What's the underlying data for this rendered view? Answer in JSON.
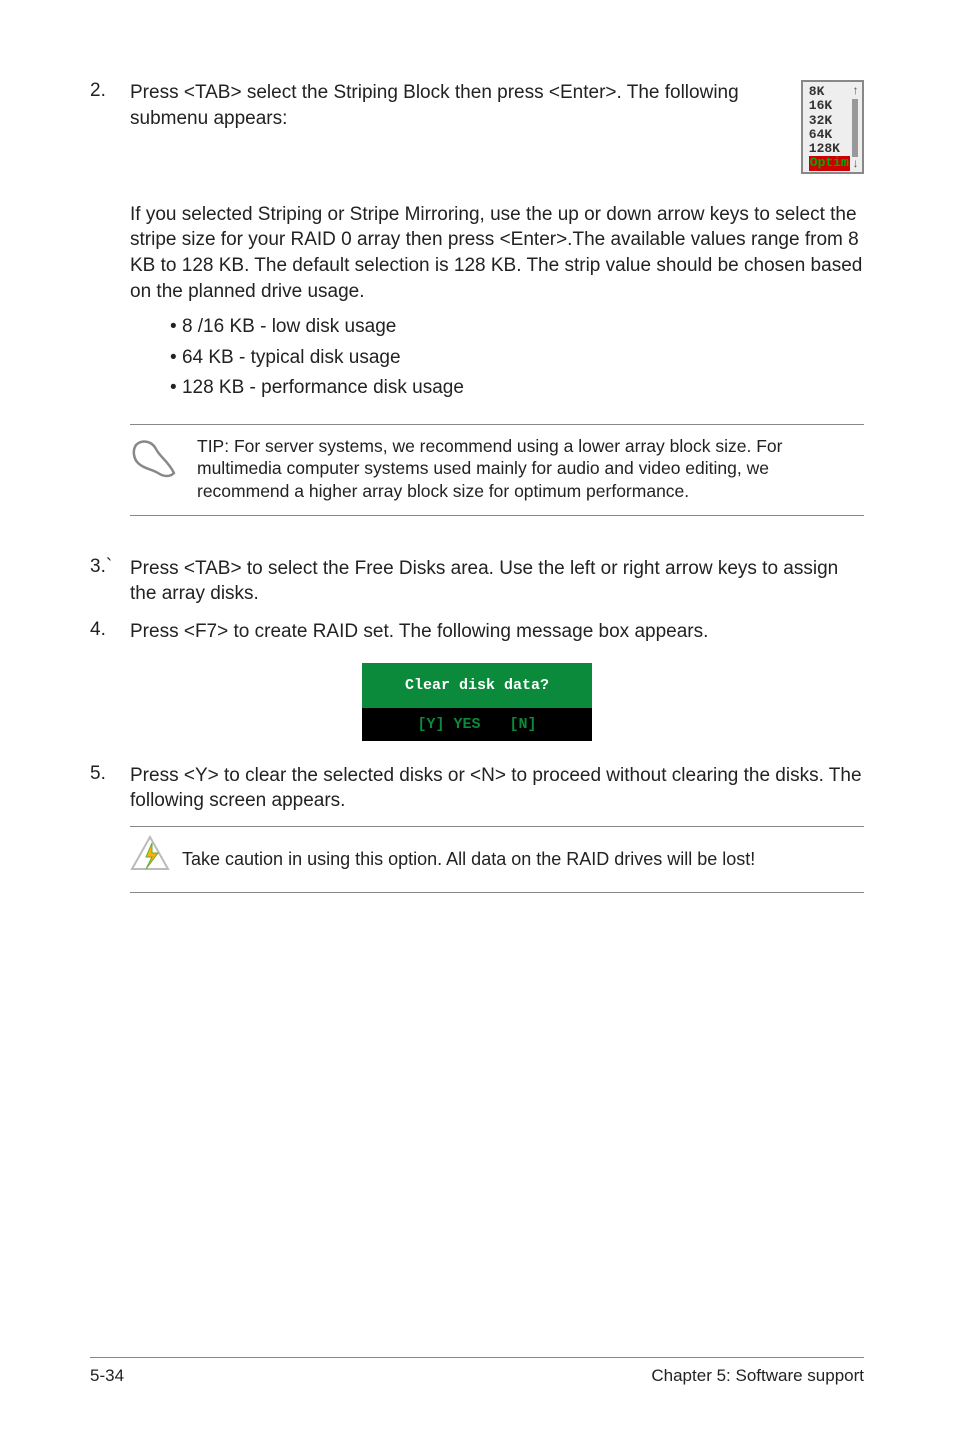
{
  "step2": {
    "num": "2.",
    "text": "Press <TAB> select the Striping Block then press <Enter>. The following submenu appears:",
    "submenu": {
      "items": [
        "8K",
        "16K",
        "32K",
        "64K",
        "128K"
      ],
      "highlighted": "Optim"
    }
  },
  "striping_para": "If you selected Striping or Stripe Mirroring, use the up or down arrow keys to select the stripe size for your RAID 0 array then press <Enter>.The available values range from 8 KB to 128 KB. The default selection is 128 KB. The strip value should be chosen based on the planned drive usage.",
  "usage_list": [
    "8 /16 KB - low disk usage",
    "64 KB - typical disk usage",
    "128 KB - performance disk usage"
  ],
  "tip": "TIP: For server systems, we recommend using a lower array block size. For multimedia computer systems used mainly for audio and video editing, we recommend a higher array block size for optimum performance.",
  "step3": {
    "num": "3.`",
    "text": "Press <TAB> to select the Free Disks area. Use the left or right arrow keys to assign the array disks."
  },
  "step4": {
    "num": "4.",
    "text": "Press <F7> to create RAID set. The following message box appears."
  },
  "msgbox": {
    "title": "Clear disk data?",
    "yes": "[Y] YES",
    "no": "[N]"
  },
  "step5": {
    "num": "5.",
    "text": "Press <Y> to clear the selected disks or <N> to proceed without clearing the disks. The following screen appears."
  },
  "caution": "Take caution in using this option. All data on the RAID drives will be lost!",
  "footer": {
    "left": "5-34",
    "right": "Chapter 5: Software support"
  }
}
